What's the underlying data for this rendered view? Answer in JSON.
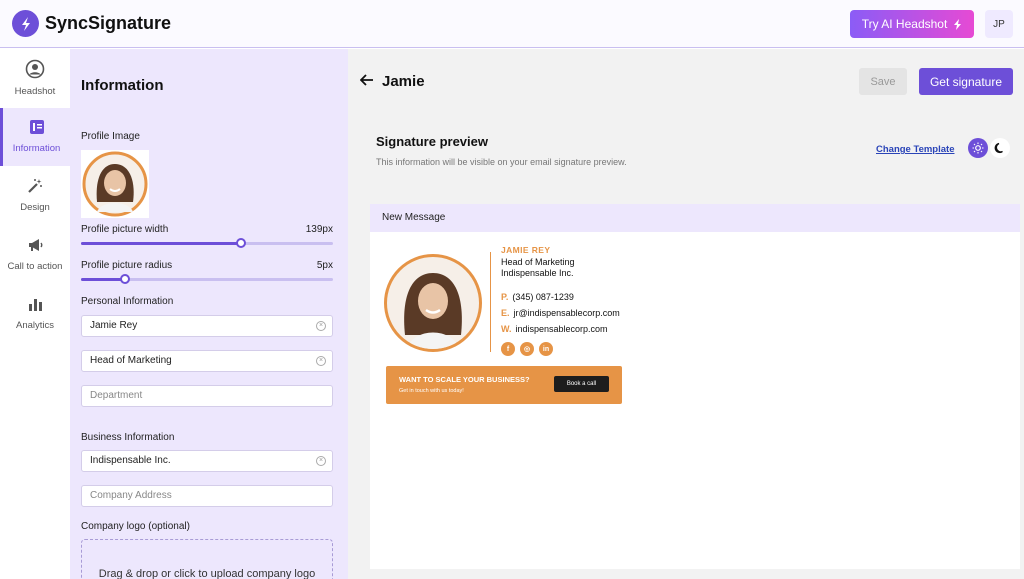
{
  "app": {
    "name": "SyncSignature",
    "try_button": "Try AI Headshot",
    "user_initials": "JP"
  },
  "nav": [
    {
      "label": "Headshot",
      "icon": "user-circle-icon"
    },
    {
      "label": "Information",
      "icon": "card-icon"
    },
    {
      "label": "Design",
      "icon": "magic-wand-icon"
    },
    {
      "label": "Call to action",
      "icon": "megaphone-icon"
    },
    {
      "label": "Analytics",
      "icon": "bar-chart-icon"
    }
  ],
  "panel": {
    "title": "Information",
    "profile_image_label": "Profile Image",
    "width_label": "Profile picture width",
    "width_value": "139px",
    "width_fraction": 0.64,
    "radius_label": "Profile picture radius",
    "radius_value": "5px",
    "radius_fraction": 0.17,
    "personal_label": "Personal Information",
    "name_value": "Jamie Rey",
    "title_value": "Head of Marketing",
    "department_placeholder": "Department",
    "business_label": "Business Information",
    "company_value": "Indispensable Inc.",
    "address_placeholder": "Company Address",
    "logo_label": "Company logo (optional)",
    "upload_text": "Drag & drop or click to upload company logo"
  },
  "main": {
    "title": "Jamie",
    "save_label": "Save",
    "get_label": "Get signature",
    "preview_title": "Signature preview",
    "preview_sub": "This information will be visible on your email signature preview.",
    "change_template": "Change Template"
  },
  "message": {
    "header": "New Message",
    "name": "JAMIE REY",
    "job": "Head of Marketing",
    "company": "Indispensable Inc.",
    "phone_prefix": "P.",
    "phone": "(345) 087-1239",
    "email_prefix": "E.",
    "email": "jr@indispensablecorp.com",
    "web_prefix": "W.",
    "web": "indispensablecorp.com",
    "banner_title": "WANT TO SCALE YOUR BUSINESS?",
    "banner_sub": "Get in touch with us today!",
    "book_label": "Book a call"
  },
  "colors": {
    "accent": "#6d4fd8",
    "signature_accent": "#e69446",
    "panel_bg": "#ede7fd"
  }
}
